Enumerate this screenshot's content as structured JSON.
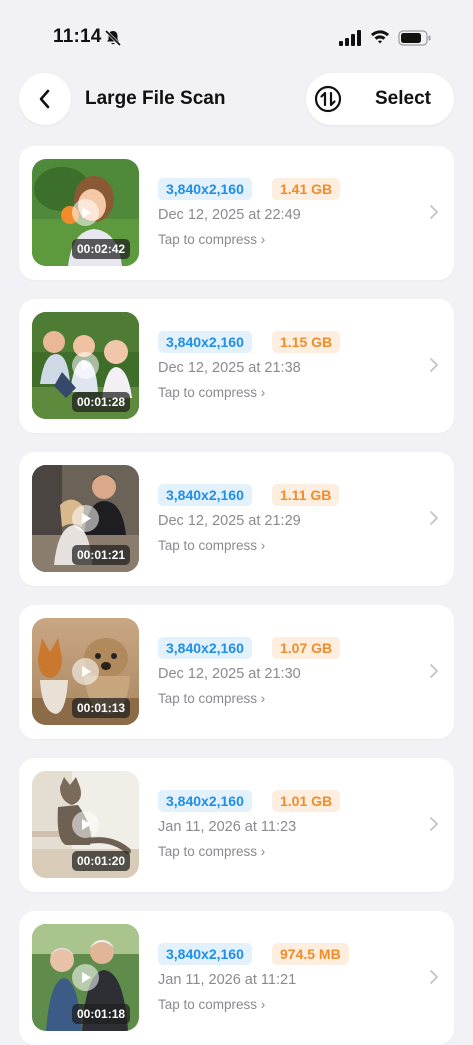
{
  "status": {
    "time": "11:14"
  },
  "header": {
    "title": "Large File Scan",
    "select_label": "Select"
  },
  "colors": {
    "resolution_text": "#1e8ee6",
    "resolution_bg": "#e3f1fd",
    "size_text": "#f28c2a",
    "size_bg": "#fdeee0",
    "background": "#f2f2f6"
  },
  "icons": [
    "bell-slash-icon",
    "cellular-signal-icon",
    "wifi-icon",
    "battery-icon",
    "back-arrow-icon",
    "sort-icon",
    "play-icon",
    "chevron-right-icon"
  ],
  "files": [
    {
      "resolution": "3,840x2,160",
      "size": "1.41 GB",
      "date": "Dec 12, 2025 at 22:49",
      "action": "Tap to compress ›",
      "duration": "00:02:42",
      "thumbnail": "girl-eating-fruit"
    },
    {
      "resolution": "3,840x2,160",
      "size": "1.15 GB",
      "date": "Dec 12, 2025 at 21:38",
      "action": "Tap to compress ›",
      "duration": "00:01:28",
      "thumbnail": "three-children-on-grass"
    },
    {
      "resolution": "3,840x2,160",
      "size": "1.11 GB",
      "date": "Dec 12, 2025 at 21:29",
      "action": "Tap to compress ›",
      "duration": "00:01:21",
      "thumbnail": "family-sitting-on-steps"
    },
    {
      "resolution": "3,840x2,160",
      "size": "1.07 GB",
      "date": "Dec 12, 2025 at 21:30",
      "action": "Tap to compress ›",
      "duration": "00:01:13",
      "thumbnail": "two-dogs"
    },
    {
      "resolution": "3,840x2,160",
      "size": "1.01 GB",
      "date": "Jan 11, 2026 at 11:23",
      "action": "Tap to compress ›",
      "duration": "00:01:20",
      "thumbnail": "cat-on-stairs"
    },
    {
      "resolution": "3,840x2,160",
      "size": "974.5 MB",
      "date": "Jan 11, 2026 at 11:21",
      "action": "Tap to compress ›",
      "duration": "00:01:18",
      "thumbnail": "elderly-couple"
    }
  ]
}
